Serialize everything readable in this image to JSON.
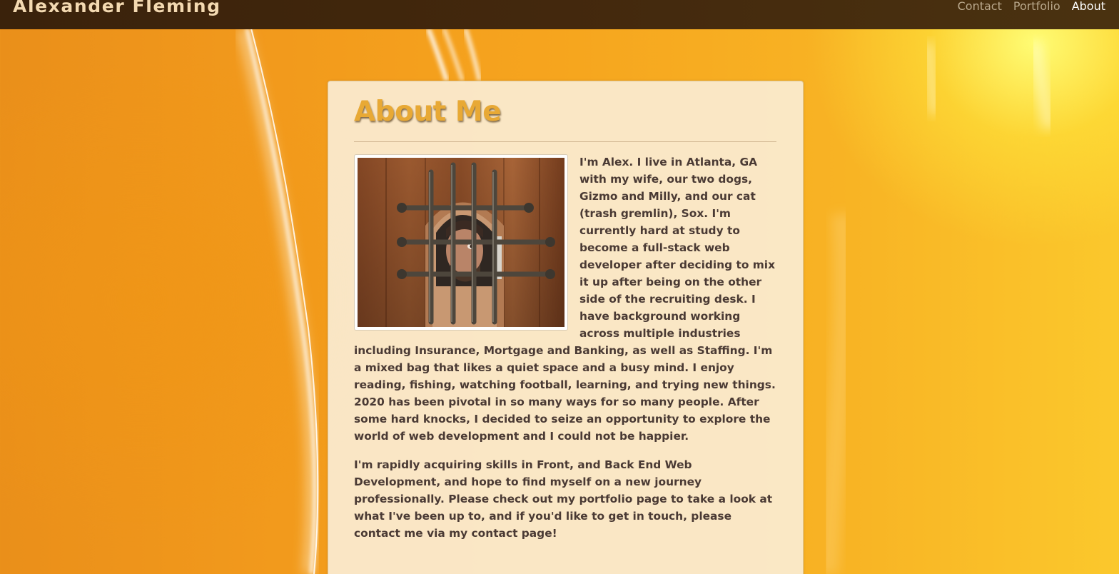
{
  "brand": {
    "name": "Alexander Fleming"
  },
  "nav": {
    "items": [
      {
        "label": "Contact",
        "active": false
      },
      {
        "label": "Portfolio",
        "active": false
      },
      {
        "label": "About",
        "active": true
      }
    ]
  },
  "main": {
    "title": "About Me",
    "paragraphs": [
      "I'm Alex. I live in Atlanta, GA with my wife, our two dogs, Gizmo and Milly, and our cat (trash gremlin), Sox. I'm currently hard at study to become a full-stack web developer after deciding to mix it up after being on the other side of the recruiting desk. I have background working across multiple industries including Insurance, Mortgage and Banking, as well as Staffing. I'm a mixed bag that likes a quiet space and a busy mind. I enjoy reading, fishing, watching football, learning, and trying new things. 2020 has been pivotal in so many ways for so many people. After some hard knocks, I decided to seize an opportunity to explore the world of web development and I could not be happier.",
      "I'm rapidly acquiring skills in Front, and Back End Web Development, and hope to find myself on a new journey professionally. Please check out my portfolio page to take a look at what I've been up to, and if you'd like to get in touch, please contact me via my contact page!"
    ]
  },
  "colors": {
    "navbar_bg": "#3a220b",
    "brand_text": "#f3d9b1",
    "nav_link": "#b9a88c",
    "nav_link_active": "#ffffff",
    "title": "#e8a935",
    "body_text": "#4a3a34",
    "card_bg": "#faecd2",
    "page_bg": "#f29a1c"
  }
}
